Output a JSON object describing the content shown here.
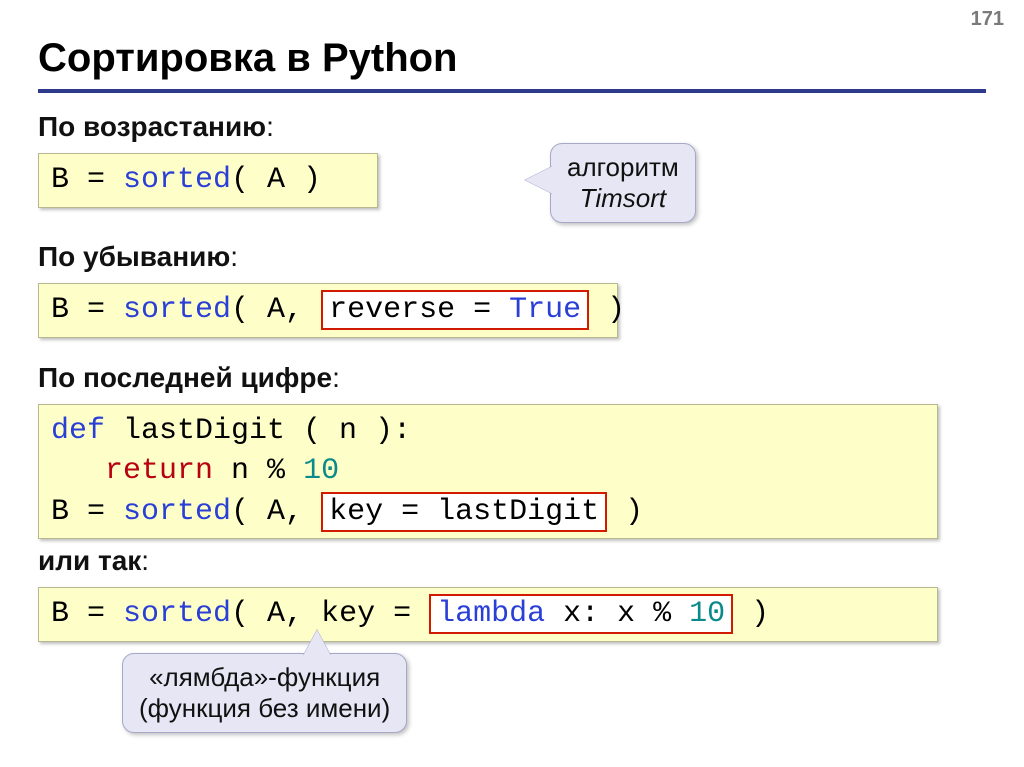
{
  "page_number": "171",
  "title": "Сортировка в Python",
  "sections": {
    "asc": {
      "label_bold": "По возрастанию",
      "colon": ":"
    },
    "desc": {
      "label_bold": "По убыванию",
      "colon": ":"
    },
    "last": {
      "label_bold": "По последней цифре",
      "colon": ":"
    },
    "or": {
      "label_bold": "или так",
      "colon": ":"
    }
  },
  "code": {
    "asc": {
      "pre": "B = ",
      "sorted": "sorted",
      "post": "( A )"
    },
    "desc": {
      "pre": "B = ",
      "sorted": "sorted",
      "open": "( A, ",
      "frame_pre": "reverse = ",
      "frame_true": "True",
      "close": " )"
    },
    "last": {
      "line1_def": "def",
      "line1_rest": " lastDigit ( n ):",
      "line2_indent": "   ",
      "line2_return": "return",
      "line2_mid": " n % ",
      "line2_ten": "10",
      "line3_pre": "B = ",
      "line3_sorted": "sorted",
      "line3_open": "( A, ",
      "line3_frame": "key = lastDigit",
      "line3_close": " )"
    },
    "lambda": {
      "pre": "B = ",
      "sorted": "sorted",
      "open": "( A, key = ",
      "frame_kw": "lambda",
      "frame_mid": " x: x % ",
      "frame_ten": "10",
      "close": " )"
    }
  },
  "callouts": {
    "timsort": {
      "line1": "алгоритм",
      "line2": "Timsort"
    },
    "lambda": {
      "line1": "«лямбда»-функция",
      "line2": "(функция без имени)"
    }
  }
}
